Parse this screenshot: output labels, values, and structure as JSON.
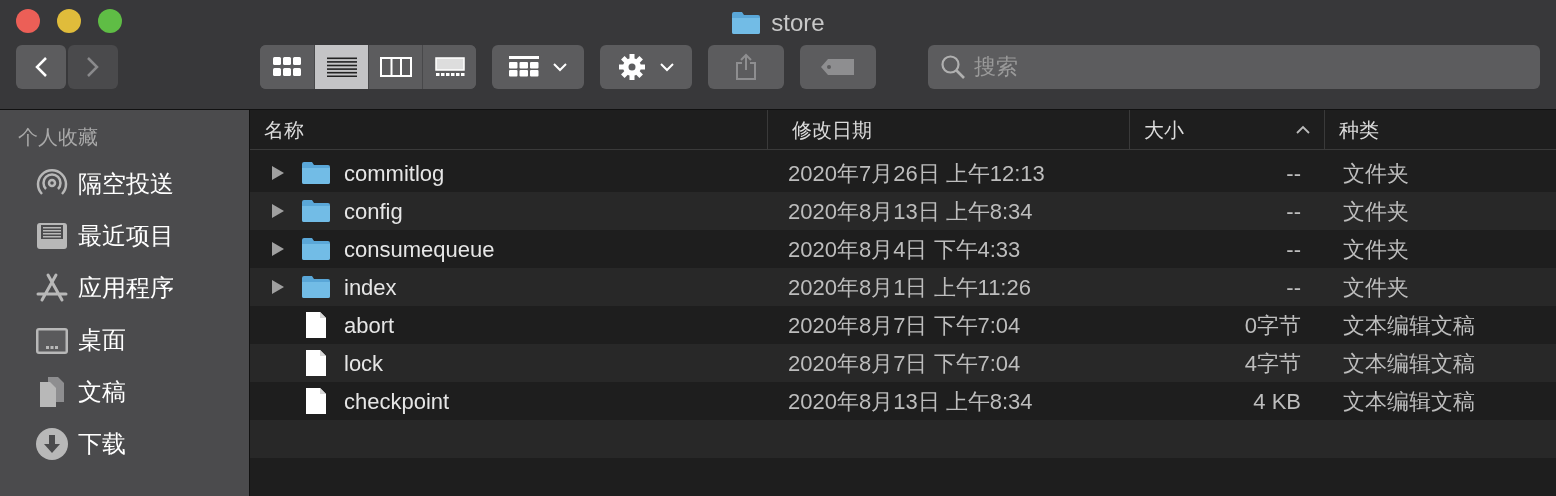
{
  "window": {
    "title": "store"
  },
  "toolbar": {
    "nav": [
      {
        "kind": "back",
        "disabled": false
      },
      {
        "kind": "forward",
        "disabled": true
      }
    ],
    "views": [
      {
        "kind": "icons",
        "selected": false
      },
      {
        "kind": "list",
        "selected": true
      },
      {
        "kind": "columns",
        "selected": false
      },
      {
        "kind": "gallery",
        "selected": false
      }
    ],
    "search": {
      "placeholder": "搜索"
    }
  },
  "sidebar": {
    "heading": "个人收藏",
    "items": [
      {
        "kind": "airdrop",
        "label": "隔空投送"
      },
      {
        "kind": "recents",
        "label": "最近项目"
      },
      {
        "kind": "applications",
        "label": "应用程序"
      },
      {
        "kind": "desktop",
        "label": "桌面"
      },
      {
        "kind": "documents",
        "label": "文稿"
      },
      {
        "kind": "downloads",
        "label": "下载"
      }
    ]
  },
  "table": {
    "columns": [
      {
        "label": "名称",
        "sorted": false
      },
      {
        "label": "修改日期",
        "sorted": false
      },
      {
        "label": "大小",
        "sorted": true
      },
      {
        "label": "种类",
        "sorted": false
      }
    ],
    "rows": [
      {
        "kind": "folder",
        "name": "commitlog",
        "modified": "2020年7月26日 上午12:13",
        "size": "--",
        "type": "文件夹"
      },
      {
        "kind": "folder",
        "name": "config",
        "modified": "2020年8月13日 上午8:34",
        "size": "--",
        "type": "文件夹"
      },
      {
        "kind": "folder",
        "name": "consumequeue",
        "modified": "2020年8月4日 下午4:33",
        "size": "--",
        "type": "文件夹"
      },
      {
        "kind": "folder",
        "name": "index",
        "modified": "2020年8月1日 上午11:26",
        "size": "--",
        "type": "文件夹"
      },
      {
        "kind": "file",
        "name": "abort",
        "modified": "2020年8月7日 下午7:04",
        "size": "0字节",
        "type": "文本编辑文稿"
      },
      {
        "kind": "file",
        "name": "lock",
        "modified": "2020年8月7日 下午7:04",
        "size": "4字节",
        "type": "文本编辑文稿"
      },
      {
        "kind": "file",
        "name": "checkpoint",
        "modified": "2020年8月13日 上午8:34",
        "size": "4 KB",
        "type": "文本编辑文稿"
      }
    ]
  }
}
